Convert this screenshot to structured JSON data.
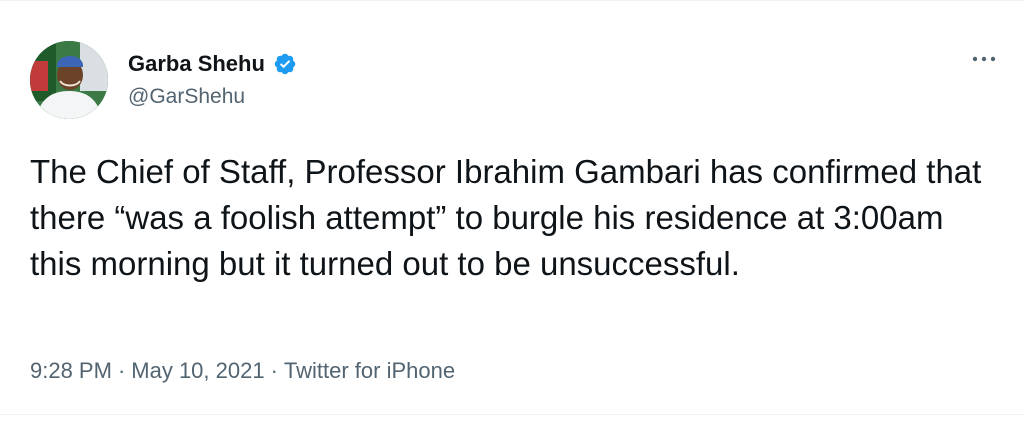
{
  "author": {
    "name": "Garba Shehu",
    "handle": "@GarShehu",
    "verified": true,
    "avatar_icon": "profile-photo"
  },
  "more_menu": {
    "icon": "more-options-icon"
  },
  "tweet": {
    "text": "The Chief of Staff, Professor Ibrahim Gambari has confirmed that there “was a foolish attempt” to burgle his residence at 3:00am this morning but it turned out to be unsuccessful."
  },
  "meta": {
    "time": "9:28 PM",
    "separator": "·",
    "date": "May 10, 2021",
    "source": "Twitter for iPhone"
  },
  "colors": {
    "text": "#0f1419",
    "secondary": "#536471",
    "verified_badge": "#1d9bf0",
    "divider": "#eff3f4"
  }
}
